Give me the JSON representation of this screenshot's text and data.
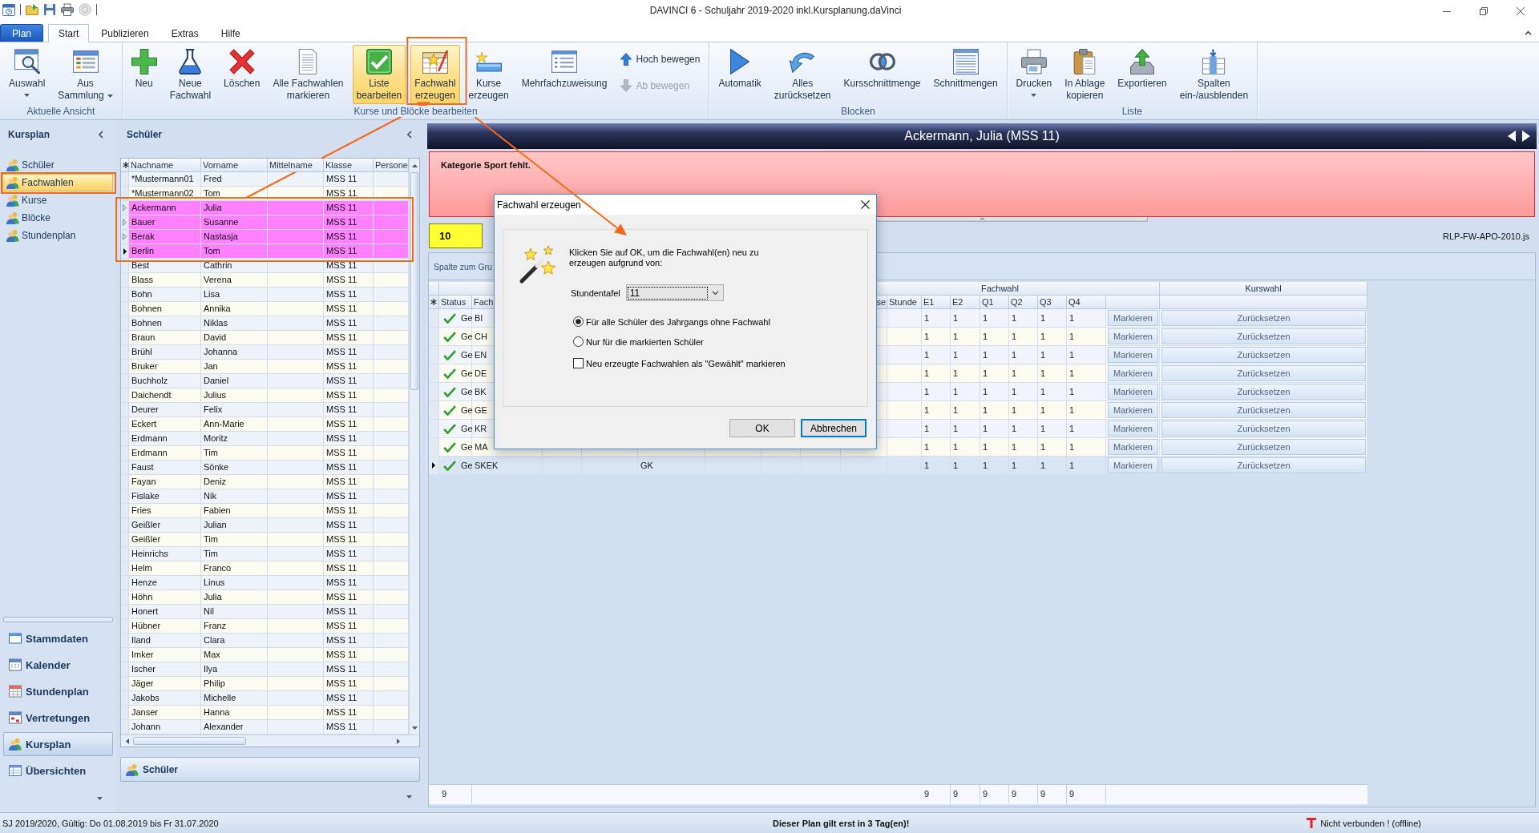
{
  "window": {
    "title": "DAVINCI 6 - Schuljahr 2019-2020 inkl.Kursplanung.daVinci"
  },
  "ribbon": {
    "app_button": "Plan",
    "tabs": [
      {
        "label": "Start",
        "selected": true
      },
      {
        "label": "Publizieren",
        "selected": false
      },
      {
        "label": "Extras",
        "selected": false
      },
      {
        "label": "Hilfe",
        "selected": false
      }
    ],
    "groups": [
      {
        "label": "Aktuelle Ansicht",
        "buttons": [
          {
            "kind": "large",
            "label": "Auswahl",
            "dropdown": true,
            "highlighted": false,
            "disabled": false
          },
          {
            "kind": "large",
            "label": "Aus\nSammlung",
            "dropdown": true,
            "highlighted": false,
            "disabled": false
          }
        ]
      },
      {
        "label": "Kurse und Blöcke bearbeiten",
        "buttons": [
          {
            "kind": "large",
            "label": "Neu",
            "dropdown": false,
            "highlighted": false,
            "disabled": false
          },
          {
            "kind": "large",
            "label": "Neue\nFachwahl",
            "dropdown": false,
            "highlighted": false,
            "disabled": false
          },
          {
            "kind": "large",
            "label": "Löschen",
            "dropdown": false,
            "highlighted": false,
            "disabled": false
          },
          {
            "kind": "large",
            "label": "Alle Fachwahlen\nmarkieren",
            "dropdown": false,
            "highlighted": false,
            "disabled": false
          },
          {
            "kind": "large",
            "label": "Liste\nbearbeiten",
            "dropdown": false,
            "highlighted": true,
            "disabled": false
          },
          {
            "kind": "large",
            "label": "Fachwahl\nerzeugen",
            "dropdown": false,
            "highlighted": true,
            "disabled": false
          },
          {
            "kind": "large",
            "label": "Kurse\nerzeugen",
            "dropdown": false,
            "highlighted": false,
            "disabled": false
          },
          {
            "kind": "large",
            "label": "Mehrfachzuweisung",
            "dropdown": false,
            "highlighted": false,
            "disabled": false
          },
          {
            "kind": "small",
            "label": "Hoch bewegen",
            "dropdown": false,
            "highlighted": false,
            "disabled": false
          },
          {
            "kind": "small",
            "label": "Ab bewegen",
            "dropdown": false,
            "highlighted": false,
            "disabled": true
          }
        ]
      },
      {
        "label": "Blocken",
        "buttons": [
          {
            "kind": "large",
            "label": "Automatik",
            "dropdown": false,
            "highlighted": false,
            "disabled": false
          },
          {
            "kind": "large",
            "label": "Alles\nzurücksetzen",
            "dropdown": false,
            "highlighted": false,
            "disabled": false
          },
          {
            "kind": "large",
            "label": "Kursschnittmenge",
            "dropdown": false,
            "highlighted": false,
            "disabled": false
          },
          {
            "kind": "large",
            "label": "Schnittmengen",
            "dropdown": false,
            "highlighted": false,
            "disabled": false
          }
        ]
      },
      {
        "label": "Liste",
        "buttons": [
          {
            "kind": "large",
            "label": "Drucken",
            "dropdown": true,
            "highlighted": false,
            "disabled": false
          },
          {
            "kind": "large",
            "label": "In Ablage\nkopieren",
            "dropdown": false,
            "highlighted": false,
            "disabled": false
          },
          {
            "kind": "large",
            "label": "Exportieren",
            "dropdown": false,
            "highlighted": false,
            "disabled": false
          },
          {
            "kind": "large",
            "label": "Spalten\nein-/ausblenden",
            "dropdown": false,
            "highlighted": false,
            "disabled": false
          }
        ]
      }
    ]
  },
  "nav_pane": {
    "title": "Kursplan",
    "items": [
      {
        "label": "Schüler",
        "selected": false
      },
      {
        "label": "Fachwahlen",
        "selected": true
      },
      {
        "label": "Kurse",
        "selected": false
      },
      {
        "label": "Blöcke",
        "selected": false
      },
      {
        "label": "Stundenplan",
        "selected": false
      }
    ],
    "sections": [
      {
        "label": "Stammdaten",
        "selected": false
      },
      {
        "label": "Kalender",
        "selected": false
      },
      {
        "label": "Stundenplan",
        "selected": false
      },
      {
        "label": "Vertretungen",
        "selected": false
      },
      {
        "label": "Kursplan",
        "selected": true
      },
      {
        "label": "Übersichten",
        "selected": false
      }
    ]
  },
  "student_pane": {
    "title": "Schüler",
    "columns": [
      "Nachname",
      "Vorname",
      "Mittelname",
      "Klasse",
      "Persone"
    ],
    "rows": [
      {
        "last_name": "*Mustermann01",
        "first_name": "Fred",
        "class": "MSS 11",
        "selected": false,
        "current": false
      },
      {
        "last_name": "*Mustermann02",
        "first_name": "Tom",
        "class": "MSS 11",
        "selected": false,
        "current": false
      },
      {
        "last_name": "Ackermann",
        "first_name": "Julia",
        "class": "MSS 11",
        "selected": true,
        "current": false
      },
      {
        "last_name": "Bauer",
        "first_name": "Susanne",
        "class": "MSS 11",
        "selected": true,
        "current": false
      },
      {
        "last_name": "Berak",
        "first_name": "Nastasja",
        "class": "MSS 11",
        "selected": true,
        "current": false
      },
      {
        "last_name": "Berlin",
        "first_name": "Tom",
        "class": "MSS 11",
        "selected": true,
        "current": true
      },
      {
        "last_name": "Best",
        "first_name": "Cathrin",
        "class": "MSS 11",
        "selected": false,
        "current": false
      },
      {
        "last_name": "Blass",
        "first_name": "Verena",
        "class": "MSS 11",
        "selected": false,
        "current": false
      },
      {
        "last_name": "Bohn",
        "first_name": "Lisa",
        "class": "MSS 11",
        "selected": false,
        "current": false
      },
      {
        "last_name": "Bohnen",
        "first_name": "Annika",
        "class": "MSS 11",
        "selected": false,
        "current": false
      },
      {
        "last_name": "Bohnen",
        "first_name": "Niklas",
        "class": "MSS 11",
        "selected": false,
        "current": false
      },
      {
        "last_name": "Braun",
        "first_name": "David",
        "class": "MSS 11",
        "selected": false,
        "current": false
      },
      {
        "last_name": "Brühl",
        "first_name": "Johanna",
        "class": "MSS 11",
        "selected": false,
        "current": false
      },
      {
        "last_name": "Bruker",
        "first_name": "Jan",
        "class": "MSS 11",
        "selected": false,
        "current": false
      },
      {
        "last_name": "Buchholz",
        "first_name": "Daniel",
        "class": "MSS 11",
        "selected": false,
        "current": false
      },
      {
        "last_name": "Daichendt",
        "first_name": "Julius",
        "class": "MSS 11",
        "selected": false,
        "current": false
      },
      {
        "last_name": "Deurer",
        "first_name": "Felix",
        "class": "MSS 11",
        "selected": false,
        "current": false
      },
      {
        "last_name": "Eckert",
        "first_name": "Ann-Marie",
        "class": "MSS 11",
        "selected": false,
        "current": false
      },
      {
        "last_name": "Erdmann",
        "first_name": "Moritz",
        "class": "MSS 11",
        "selected": false,
        "current": false
      },
      {
        "last_name": "Erdmann",
        "first_name": "Tim",
        "class": "MSS 11",
        "selected": false,
        "current": false
      },
      {
        "last_name": "Faust",
        "first_name": "Sönke",
        "class": "MSS 11",
        "selected": false,
        "current": false
      },
      {
        "last_name": "Fayan",
        "first_name": "Deniz",
        "class": "MSS 11",
        "selected": false,
        "current": false
      },
      {
        "last_name": "Fislake",
        "first_name": "Nik",
        "class": "MSS 11",
        "selected": false,
        "current": false
      },
      {
        "last_name": "Fries",
        "first_name": "Fabien",
        "class": "MSS 11",
        "selected": false,
        "current": false
      },
      {
        "last_name": "Geißler",
        "first_name": "Julian",
        "class": "MSS 11",
        "selected": false,
        "current": false
      },
      {
        "last_name": "Geißler",
        "first_name": "Tim",
        "class": "MSS 11",
        "selected": false,
        "current": false
      },
      {
        "last_name": "Heinrichs",
        "first_name": "Tim",
        "class": "MSS 11",
        "selected": false,
        "current": false
      },
      {
        "last_name": "Helm",
        "first_name": "Franco",
        "class": "MSS 11",
        "selected": false,
        "current": false
      },
      {
        "last_name": "Henze",
        "first_name": "Linus",
        "class": "MSS 11",
        "selected": false,
        "current": false
      },
      {
        "last_name": "Höhn",
        "first_name": "Julia",
        "class": "MSS 11",
        "selected": false,
        "current": false
      },
      {
        "last_name": "Honert",
        "first_name": "Nil",
        "class": "MSS 11",
        "selected": false,
        "current": false
      },
      {
        "last_name": "Hübner",
        "first_name": "Franz",
        "class": "MSS 11",
        "selected": false,
        "current": false
      },
      {
        "last_name": "Iland",
        "first_name": "Clara",
        "class": "MSS 11",
        "selected": false,
        "current": false
      },
      {
        "last_name": "Imker",
        "first_name": "Max",
        "class": "MSS 11",
        "selected": false,
        "current": false
      },
      {
        "last_name": "Ischer",
        "first_name": "Ilya",
        "class": "MSS 11",
        "selected": false,
        "current": false
      },
      {
        "last_name": "Jäger",
        "first_name": "Philip",
        "class": "MSS 11",
        "selected": false,
        "current": false
      },
      {
        "last_name": "Jakobs",
        "first_name": "Michelle",
        "class": "MSS 11",
        "selected": false,
        "current": false
      },
      {
        "last_name": "Janser",
        "first_name": "Hanna",
        "class": "MSS 11",
        "selected": false,
        "current": false
      },
      {
        "last_name": "Johann",
        "first_name": "Alexander",
        "class": "MSS 11",
        "selected": false,
        "current": false
      }
    ],
    "footer_button": "Schüler"
  },
  "detail_pane": {
    "title": "Ackermann, Julia (MSS 11)",
    "message": "Kategorie Sport fehlt.",
    "count": "10",
    "rule_file": "RLP-FW-APO-2010.js",
    "group_hint": "Spalte zum Gru",
    "grid": {
      "bands": [
        "Fachwahl",
        "Kurswahl"
      ],
      "columns_left": [
        "Status",
        "Fach"
      ],
      "columns_right": [
        "se",
        "Stunde",
        "E1",
        "E2",
        "Q1",
        "Q2",
        "Q3",
        "Q4"
      ],
      "rows": [
        {
          "status": "Ge",
          "subject": "BI",
          "periods": [
            "1",
            "1",
            "1",
            "1",
            "1",
            "1"
          ],
          "mark_action": "Markieren",
          "reset_action": "Zurücksetzen",
          "current": false
        },
        {
          "status": "Ge",
          "subject": "CH",
          "periods": [
            "1",
            "1",
            "1",
            "1",
            "1",
            "1"
          ],
          "mark_action": "Markieren",
          "reset_action": "Zurücksetzen",
          "current": false
        },
        {
          "status": "Ge",
          "subject": "EN",
          "periods": [
            "1",
            "1",
            "1",
            "1",
            "1",
            "1"
          ],
          "mark_action": "Markieren",
          "reset_action": "Zurücksetzen",
          "current": false
        },
        {
          "status": "Ge",
          "subject": "DE",
          "periods": [
            "1",
            "1",
            "1",
            "1",
            "1",
            "1"
          ],
          "mark_action": "Markieren",
          "reset_action": "Zurücksetzen",
          "current": false
        },
        {
          "status": "Ge",
          "subject": "BK",
          "periods": [
            "1",
            "1",
            "1",
            "1",
            "1",
            "1"
          ],
          "mark_action": "Markieren",
          "reset_action": "Zurücksetzen",
          "current": false
        },
        {
          "status": "Ge",
          "subject": "GE",
          "periods": [
            "1",
            "1",
            "1",
            "1",
            "1",
            "1"
          ],
          "mark_action": "Markieren",
          "reset_action": "Zurücksetzen",
          "current": false
        },
        {
          "status": "Ge",
          "subject": "KR",
          "periods": [
            "1",
            "1",
            "1",
            "1",
            "1",
            "1"
          ],
          "mark_action": "Markieren",
          "reset_action": "Zurücksetzen",
          "current": false
        },
        {
          "status": "Ge",
          "subject": "MA",
          "periods": [
            "1",
            "1",
            "1",
            "1",
            "1",
            "1"
          ],
          "mark_action": "Markieren",
          "reset_action": "Zurücksetzen",
          "current": false
        },
        {
          "status": "Ge",
          "subject": "SKEK",
          "course_type": "GK",
          "periods": [
            "1",
            "1",
            "1",
            "1",
            "1",
            "1"
          ],
          "mark_action": "Markieren",
          "reset_action": "Zurücksetzen",
          "current": true
        }
      ],
      "footer": {
        "count": "9",
        "totals": [
          "9",
          "9",
          "9",
          "9",
          "9",
          "9"
        ]
      }
    }
  },
  "dialog": {
    "title": "Fachwahl erzeugen",
    "prompt": "Klicken Sie auf OK, um die Fachwahl(en) neu zu erzeugen aufgrund von:",
    "field_label": "Stundentafel",
    "field_value": "11",
    "options": [
      {
        "label": "Für alle Schüler des Jahrgangs ohne Fachwahl",
        "selected": true
      },
      {
        "label": "Nur für die markierten Schüler",
        "selected": false
      }
    ],
    "checkbox": {
      "label": "Neu erzeugte Fachwahlen als \"Gewählt\" markieren",
      "checked": false
    },
    "buttons": [
      {
        "label": "OK",
        "default": false
      },
      {
        "label": "Abbrechen",
        "default": true
      }
    ]
  },
  "status_bar": {
    "validity": "SJ 2019/2020, Gültig: Do 01.08.2019 bis Fr 31.07.2020",
    "notice": "Dieser Plan gilt erst in 3 Tag(en)!",
    "connection": "Nicht verbunden ! (offline)"
  }
}
